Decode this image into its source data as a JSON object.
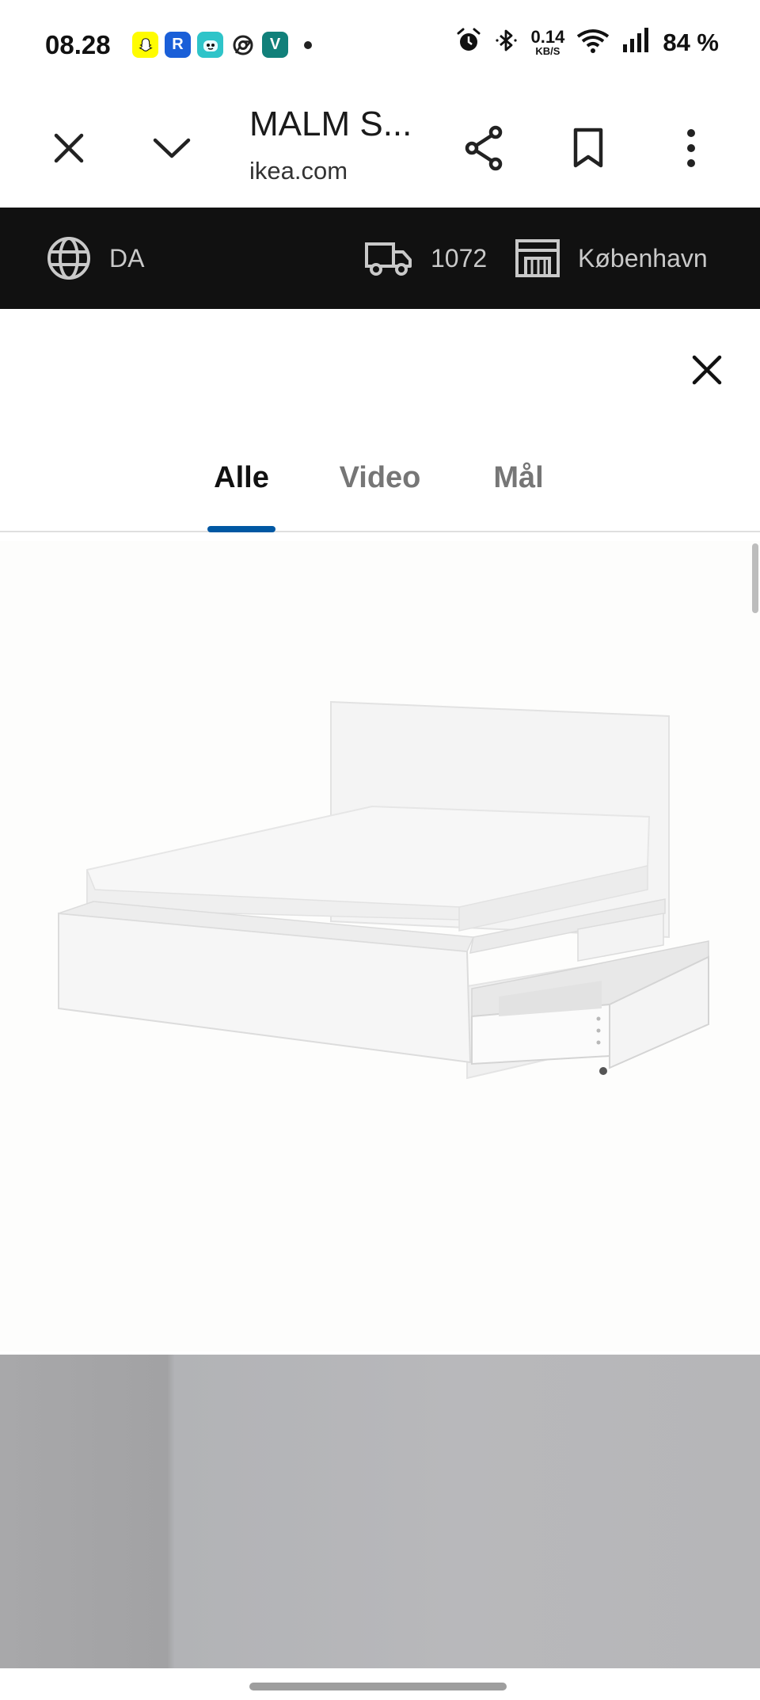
{
  "status_bar": {
    "time": "08.28",
    "notif_icons": [
      {
        "name": "snapchat-icon",
        "color": "#fffc00",
        "glyph": "👻"
      },
      {
        "name": "r-app-icon",
        "color": "#1a5fd8",
        "glyph": "R"
      },
      {
        "name": "bot-app-icon",
        "color": "#2ec4c9",
        "glyph": "☻"
      },
      {
        "name": "chrome-icon",
        "color": "#ffffff",
        "glyph": "◉"
      },
      {
        "name": "v-app-icon",
        "color": "#11807a",
        "glyph": "V"
      }
    ],
    "net_speed_value": "0.14",
    "net_speed_unit": "KB/S",
    "battery": "84 %"
  },
  "browser": {
    "title": "MALM S...",
    "domain": "ikea.com"
  },
  "ikea_header": {
    "language": "DA",
    "postal_code": "1072",
    "store": "København"
  },
  "modal": {
    "tabs": [
      {
        "label": "Alle",
        "active": true
      },
      {
        "label": "Video",
        "active": false
      },
      {
        "label": "Mål",
        "active": false
      }
    ]
  },
  "colors": {
    "accent": "#0058a3",
    "header_bg": "#111111"
  }
}
